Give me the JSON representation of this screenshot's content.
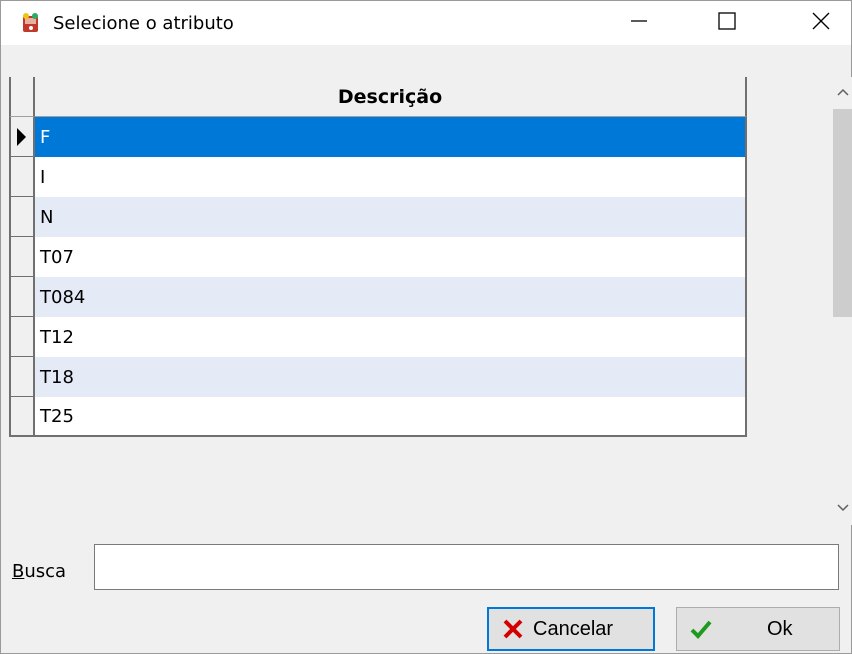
{
  "window": {
    "title": "Selecione o atributo",
    "icon": "app-icon",
    "controls": {
      "minimize": "minimize-icon",
      "maximize": "maximize-icon",
      "close": "close-icon"
    }
  },
  "grid": {
    "columns": [
      {
        "header": "Descrição"
      }
    ],
    "selected_index": 0,
    "rows": [
      {
        "descricao": "F"
      },
      {
        "descricao": "I"
      },
      {
        "descricao": "N"
      },
      {
        "descricao": "T07"
      },
      {
        "descricao": "T084"
      },
      {
        "descricao": "T12"
      },
      {
        "descricao": "T18"
      },
      {
        "descricao": "T25"
      }
    ]
  },
  "search": {
    "label_accel": "B",
    "label_rest": "usca",
    "value": ""
  },
  "buttons": {
    "cancel_label": "Cancelar",
    "ok_label": "Ok"
  },
  "colors": {
    "selection": "#0078d7",
    "alt_row": "#e4ebf7",
    "cancel_icon": "#d40000",
    "ok_icon": "#1e9b1e"
  }
}
